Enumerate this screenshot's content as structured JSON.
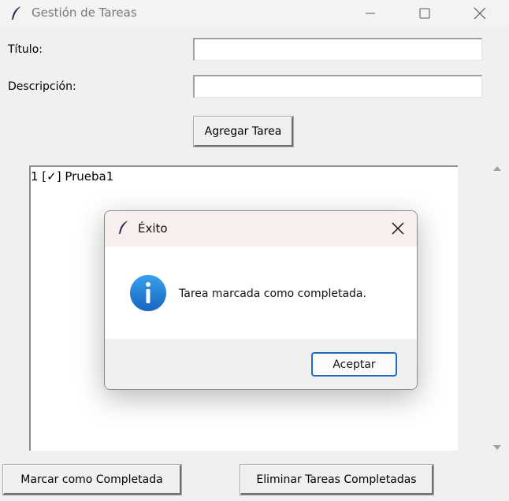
{
  "window": {
    "title": "Gestión de Tareas",
    "app_icon": "feather-icon",
    "controls": [
      "minimize-icon",
      "maximize-icon",
      "close-icon"
    ]
  },
  "form": {
    "title_label": "Título:",
    "title_value": "",
    "description_label": "Descripción:",
    "description_value": "",
    "add_button": "Agregar Tarea"
  },
  "task_list": {
    "items": [
      "1 [✓] Prueba1"
    ]
  },
  "buttons": {
    "mark_complete": "Marcar como Completada",
    "delete_completed": "Eliminar Tareas Completadas"
  },
  "dialog": {
    "title": "Éxito",
    "message": "Tarea marcada como completada.",
    "ok_button": "Aceptar",
    "icon": "info-icon",
    "accent_color": "#1f6cc7"
  }
}
